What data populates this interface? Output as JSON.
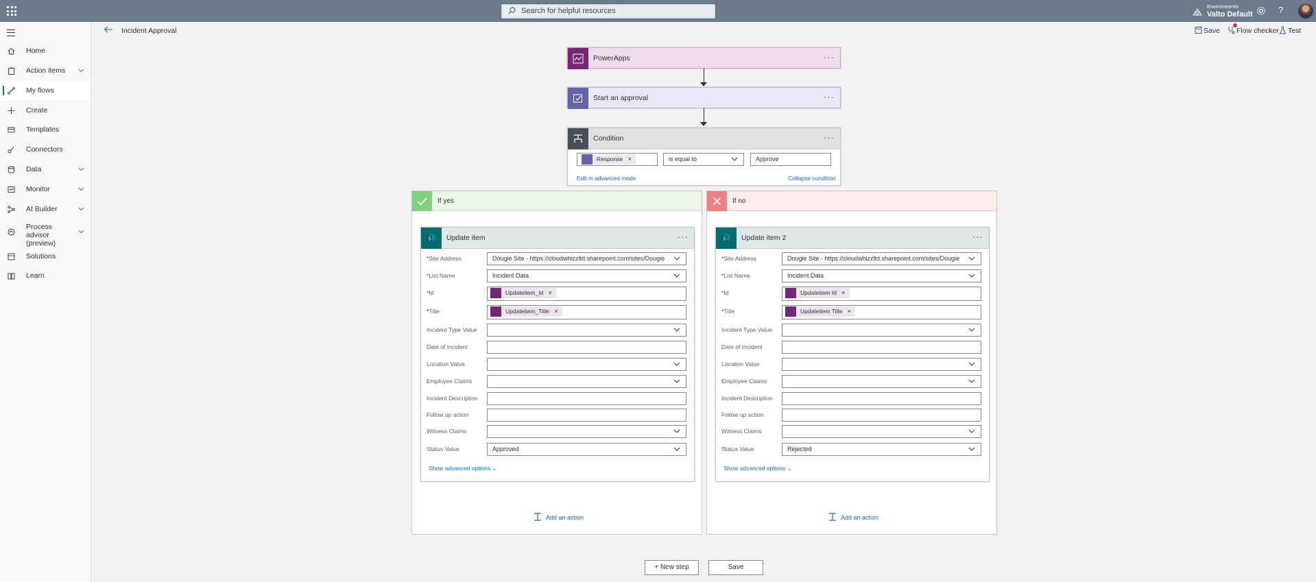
{
  "topbar": {
    "search_placeholder": "Search for helpful resources",
    "environment_label": "Environments",
    "environment_value": "Valto Default",
    "help": "?"
  },
  "sidebar": {
    "items": [
      {
        "label": "Home"
      },
      {
        "label": "Action items"
      },
      {
        "label": "My flows"
      },
      {
        "label": "Create"
      },
      {
        "label": "Templates"
      },
      {
        "label": "Connectors"
      },
      {
        "label": "Data"
      },
      {
        "label": "Monitor"
      },
      {
        "label": "AI Builder"
      },
      {
        "label": "Process advisor (preview)"
      },
      {
        "label": "Solutions"
      },
      {
        "label": "Learn"
      }
    ]
  },
  "commandbar": {
    "title": "Incident Approval",
    "save": "Save",
    "flow_checker": "Flow checker",
    "test": "Test"
  },
  "steps": {
    "trigger": {
      "title": "PowerApps",
      "more": "···"
    },
    "approval": {
      "title": "Start an approval",
      "more": "···"
    },
    "condition": {
      "title": "Condition",
      "more": "···",
      "left_token": "Response",
      "operator": "is equal to",
      "right_value": "Approve",
      "edit_advanced": "Edit in advanced mode",
      "collapse": "Collapse condition"
    }
  },
  "branches": {
    "yes": {
      "title": "If yes",
      "action": {
        "title": "Update item",
        "more": "···",
        "labels": {
          "site_address": "Site Address",
          "list_name": "List Name",
          "id": "Id",
          "title": "Title",
          "incident_type": "Incident Type Value",
          "date": "Date of Incident",
          "location": "Location Value",
          "employee_claims": "Employee Claims",
          "description": "Incident Description",
          "follow_up": "Follow up action",
          "witness": "Witness Claims",
          "status": "Status Value"
        },
        "values": {
          "site_address": "Dougie Site - https://cloudwhizzltd.sharepoint.com/sites/Dougie",
          "list_name": "Incident Data",
          "id_token": "Updateitem_Id",
          "title_token": "Updateitem_Title",
          "status": "Approved"
        },
        "advanced": "Show advanced options"
      },
      "add_action": "Add an action"
    },
    "no": {
      "title": "If no",
      "action": {
        "title": "Update item 2",
        "more": "···",
        "labels": {
          "site_address": "Site Address",
          "list_name": "List Name",
          "id": "Id",
          "title": "Title",
          "incident_type": "Incident Type Value",
          "date": "Date of Incident",
          "location": "Location Value",
          "employee_claims": "Employee Claims",
          "description": "Incident Description",
          "follow_up": "Follow up action",
          "witness": "Witness Claims",
          "status": "Status Value"
        },
        "values": {
          "site_address": "Dougie Site - https://cloudwhizzltd.sharepoint.com/sites/Dougie",
          "list_name": "Incident Data",
          "id_token": "Updateitem Id",
          "title_token": "Updateitem Title",
          "status": "Rejected"
        },
        "advanced": "Show advanced options"
      },
      "add_action": "Add an action"
    }
  },
  "footer": {
    "new_step": "+ New step",
    "save": "Save"
  },
  "colors": {
    "topbar": "#6b7b8c",
    "powerapps": "#742774",
    "approval": "#6264a7",
    "condition": "#484f58",
    "yes": "#7fd17f",
    "no": "#f08080",
    "sharepoint": "#036c70"
  }
}
